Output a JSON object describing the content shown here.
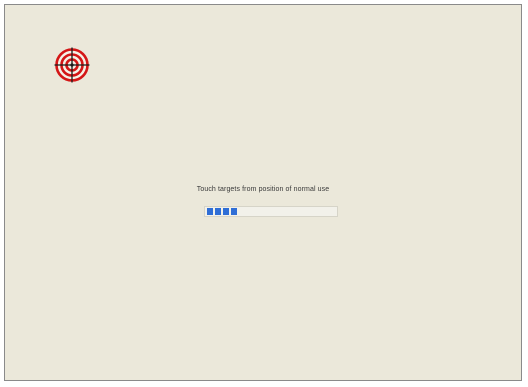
{
  "calibration": {
    "instruction": "Touch targets from position of normal use",
    "progress_fraction": 0.25
  },
  "icons": {
    "target": "crosshair-target-icon"
  },
  "colors": {
    "background": "#ebe8da",
    "target_red": "#d41616",
    "progress_blue": "#2f6ed6"
  }
}
